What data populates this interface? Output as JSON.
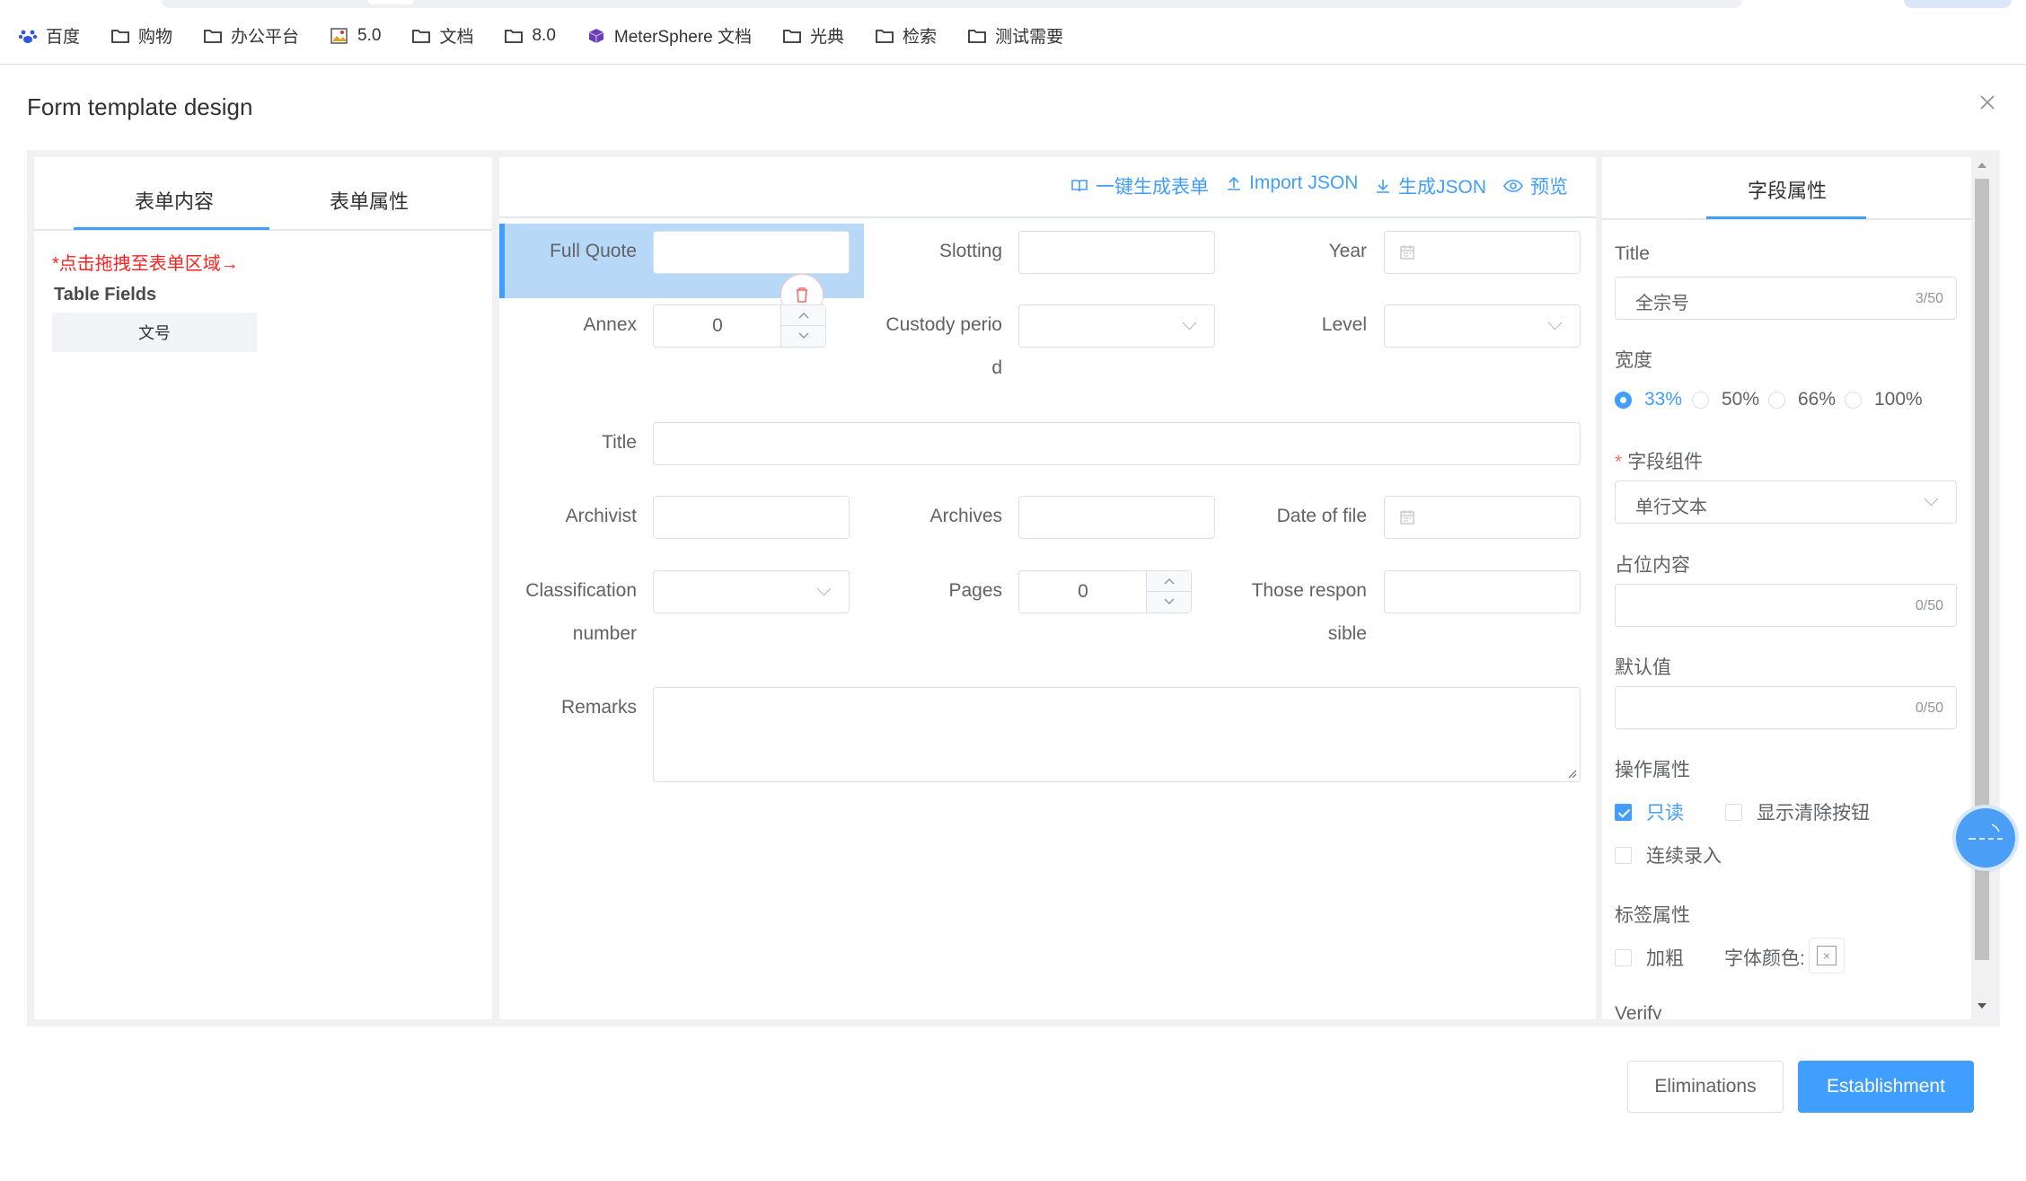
{
  "bookmarks": [
    {
      "label": "百度",
      "icon": "baidu-paw-icon"
    },
    {
      "label": "购物",
      "icon": "folder-icon"
    },
    {
      "label": "办公平台",
      "icon": "folder-icon"
    },
    {
      "label": "5.0",
      "icon": "image-bookmark-icon"
    },
    {
      "label": "文档",
      "icon": "folder-icon"
    },
    {
      "label": "8.0",
      "icon": "folder-icon"
    },
    {
      "label": "MeterSphere 文档",
      "icon": "metersphere-cube-icon"
    },
    {
      "label": "光典",
      "icon": "folder-icon"
    },
    {
      "label": "检索",
      "icon": "folder-icon"
    },
    {
      "label": "测试需要",
      "icon": "folder-icon"
    }
  ],
  "dialog": {
    "title": "Form template design"
  },
  "left_panel": {
    "tabs": [
      "表单内容",
      "表单属性"
    ],
    "hint": "*点击拖拽至表单区域→",
    "group_title": "Table Fields",
    "fields": [
      "文号"
    ]
  },
  "toolbar": {
    "generate_form": "一键生成表单",
    "import_json": "Import JSON",
    "generate_json": "生成JSON",
    "preview": "预览"
  },
  "form": {
    "full_quote_label": "Full Quote",
    "slotting_label": "Slotting",
    "year_label": "Year",
    "annex_label": "Annex",
    "annex_value": "0",
    "custody_label_1": "Custody perio",
    "custody_label_2": "d",
    "level_label": "Level",
    "title_label": "Title",
    "archivist_label": "Archivist",
    "archives_label": "Archives",
    "date_of_file_label": "Date of file",
    "classification_label_1": "Classification",
    "classification_label_2": "number",
    "pages_label": "Pages",
    "pages_value": "0",
    "responsible_label_1": "Those respon",
    "responsible_label_2": "sible",
    "remarks_label": "Remarks"
  },
  "right_panel": {
    "tab": "字段属性",
    "title_label": "Title",
    "title_value": "全宗号",
    "title_count": "3/50",
    "width_label": "宽度",
    "width_options": [
      "33%",
      "50%",
      "66%",
      "100%"
    ],
    "width_selected": "33%",
    "component_label": "字段组件",
    "component_value": "单行文本",
    "placeholder_label": "占位内容",
    "placeholder_count": "0/50",
    "default_label": "默认值",
    "default_count": "0/50",
    "operation_label": "操作属性",
    "readonly_label": "只读",
    "readonly_checked": true,
    "clearable_label": "显示清除按钮",
    "continuous_label": "连续录入",
    "tag_label": "标签属性",
    "bold_label": "加粗",
    "font_color_label": "字体颜色:",
    "verify_label": "Verify"
  },
  "footer": {
    "cancel": "Eliminations",
    "confirm": "Establishment"
  },
  "colors": {
    "primary": "#409eff",
    "active_row": "#b8d8f7",
    "danger": "#f56c6c",
    "hint": "#ff2222"
  }
}
